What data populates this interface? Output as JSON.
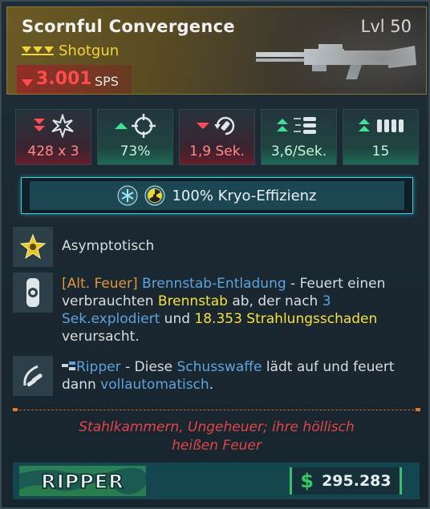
{
  "header": {
    "title": "Scornful Convergence",
    "level": "Lvl 50",
    "weapon_type": "Shotgun",
    "sps_value": "3.001",
    "sps_unit": "SPS"
  },
  "stats": [
    {
      "value": "428 x 3",
      "trend": "down",
      "icon": "damage-burst-icon"
    },
    {
      "value": "73%",
      "trend": "up",
      "icon": "crosshair-icon"
    },
    {
      "value": "1,9 Sek.",
      "trend": "down",
      "icon": "reload-icon"
    },
    {
      "value": "3,6/Sek.",
      "trend": "up",
      "icon": "fire-rate-bullets-icon"
    },
    {
      "value": "15",
      "trend": "up",
      "icon": "magazine-icon"
    }
  ],
  "efficiency": {
    "label": "100% Kryo-Effizienz"
  },
  "perks": {
    "p1": {
      "name": "Asymptotisch"
    },
    "p2": {
      "alt": "[Alt. Feuer]",
      "name": "Brennstab-Entladung",
      "t1": " - Feuert einen verbrauchten ",
      "hl1": "Brennstab",
      "t2": " ab, der nach ",
      "hl2": "3 Sek.explodiert",
      "t3": " und ",
      "hl3": "18.353 Strahlungsschaden",
      "t4": " verursacht."
    },
    "p3": {
      "name": "Ripper",
      "t1": " - Diese ",
      "hl1": "Schusswaffe",
      "t2": " lädt auf und feuert dann ",
      "hl2": "vollautomatisch",
      "t3": "."
    }
  },
  "flavor": {
    "line1": "Stahlkammern, Ungeheuer; ihre höllisch",
    "line2": "heißen Feuer"
  },
  "footer": {
    "brand": "RIPPER",
    "currency": "$",
    "price": "295.283"
  },
  "colors": {
    "accent_green": "#36c864",
    "accent_red": "#ff4b4b",
    "accent_yellow": "#f4e23a",
    "accent_blue": "#5fa3dd"
  }
}
